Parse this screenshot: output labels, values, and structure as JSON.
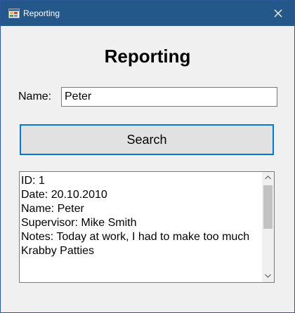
{
  "window": {
    "title": "Reporting"
  },
  "form": {
    "heading": "Reporting",
    "name_label": "Name:",
    "name_value": "Peter",
    "search_label": "Search"
  },
  "output": {
    "lines": [
      "ID: 1",
      "Date: 20.10.2010",
      "Name: Peter",
      "Supervisor: Mike Smith",
      "Notes: Today at work, I had to make too much",
      "Krabby Patties"
    ]
  },
  "icons": {
    "app": "app-window-icon",
    "close": "close-icon",
    "scroll_up": "chevron-up-icon",
    "scroll_down": "chevron-down-icon"
  },
  "colors": {
    "titlebar": "#24578a",
    "button_border": "#0078d7",
    "button_face": "#e1e1e1",
    "window_background": "#f0f0f0"
  }
}
